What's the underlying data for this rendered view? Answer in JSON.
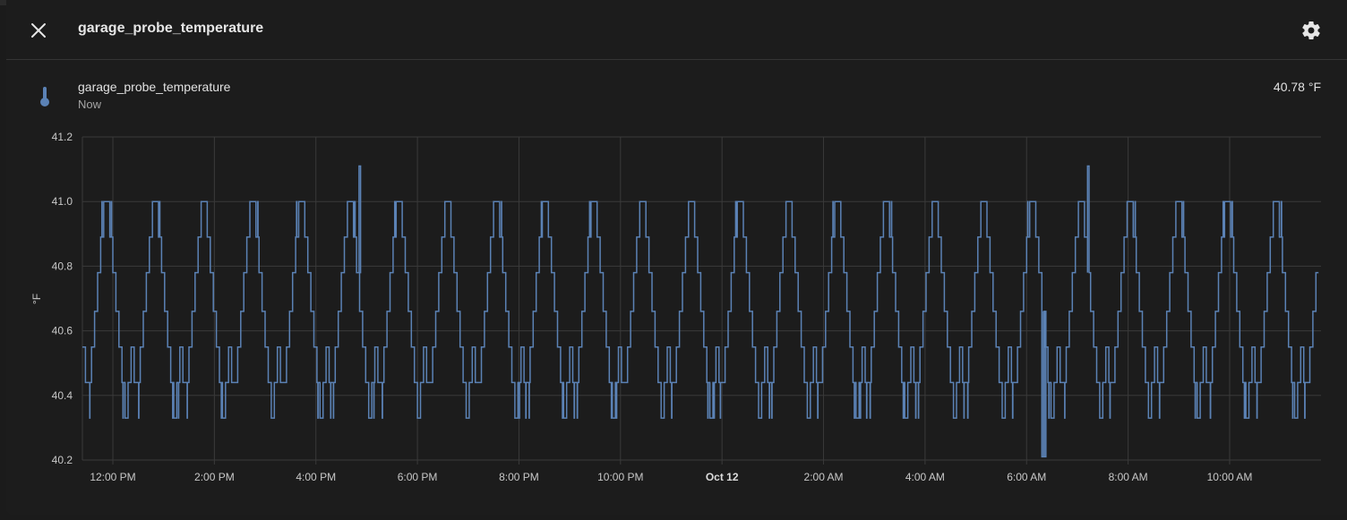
{
  "dialog": {
    "title": "garage_probe_temperature",
    "close_icon": "close-icon",
    "settings_icon": "gear-icon"
  },
  "entity": {
    "name": "garage_probe_temperature",
    "time_label": "Now",
    "value": "40.78 °F",
    "icon": "thermometer-icon"
  },
  "colors": {
    "line": "#5b82b5",
    "grid": "#3a3a3a",
    "background": "#1c1c1c"
  },
  "chart_data": {
    "type": "line",
    "title": "",
    "xlabel": "",
    "ylabel": "°F",
    "ylim": [
      40.2,
      41.2
    ],
    "y_ticks": [
      40.2,
      40.4,
      40.6,
      40.8,
      41.0,
      41.2
    ],
    "y_tick_labels": [
      "40.2",
      "40.4",
      "40.6",
      "40.8",
      "41.0",
      "41.2"
    ],
    "x_tick_labels": [
      "12:00 PM",
      "2:00 PM",
      "4:00 PM",
      "6:00 PM",
      "8:00 PM",
      "10:00 PM",
      "Oct 12",
      "2:00 AM",
      "4:00 AM",
      "6:00 AM",
      "8:00 AM",
      "10:00 AM"
    ],
    "x_tick_bold": [
      false,
      false,
      false,
      false,
      false,
      false,
      true,
      false,
      false,
      false,
      false,
      false
    ],
    "x_range_hours": [
      -0.6,
      23.8
    ],
    "x_tick_hours": [
      0,
      2,
      4,
      6,
      8,
      10,
      12,
      14,
      16,
      18,
      20,
      22
    ],
    "grid": true,
    "series": [
      {
        "step": "before",
        "cycle_hours": 0.96,
        "start_hour": -0.6,
        "end_hour": 23.75,
        "cycle_values": [
          40.55,
          40.44,
          40.44,
          40.55,
          40.66,
          40.78,
          40.89,
          41.0,
          41.0,
          40.89,
          40.78,
          40.66,
          40.55,
          40.44,
          40.33,
          40.44
        ],
        "noise_levels": [
          40.33,
          40.44,
          41.0,
          40.89
        ],
        "spikes": [
          {
            "hour": 4.85,
            "value": 41.11
          },
          {
            "hour": 19.2,
            "value": 41.11
          },
          {
            "hour": 18.3,
            "value": 40.21
          },
          {
            "hour": 18.35,
            "value": 40.21
          }
        ],
        "last_value": 40.78
      }
    ]
  }
}
